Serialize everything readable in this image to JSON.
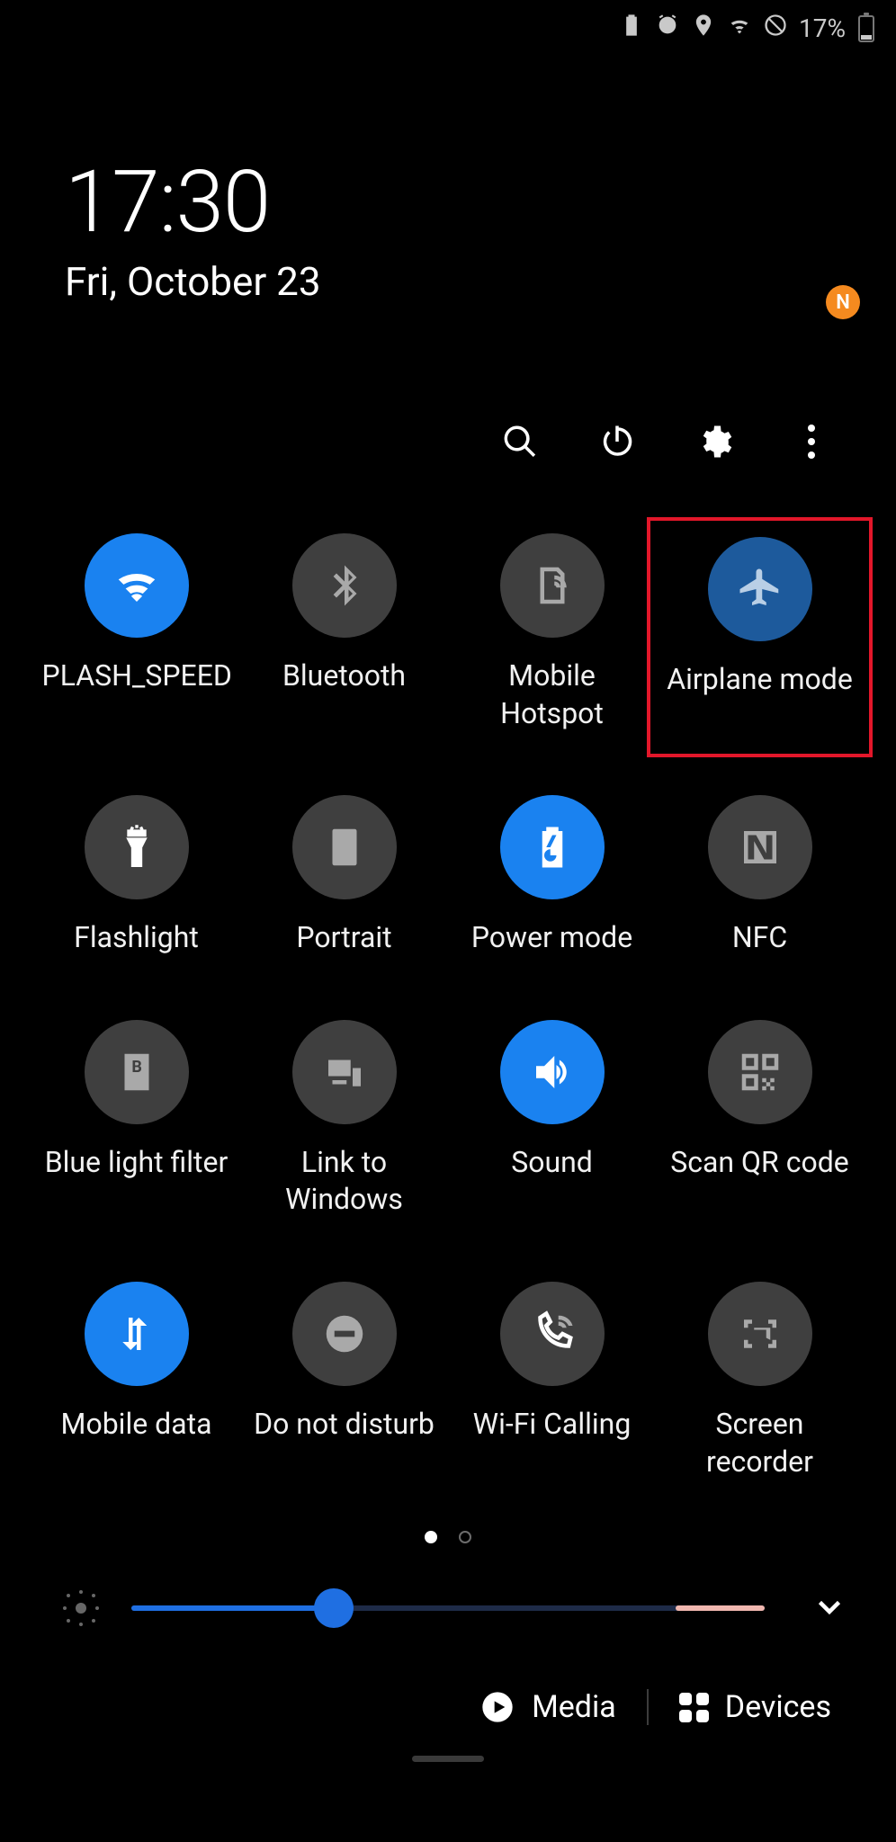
{
  "status_bar": {
    "battery_percent": "17%"
  },
  "clock": {
    "time": "17:30",
    "date": "Fri, October 23"
  },
  "action_row": {
    "badge": "N"
  },
  "tiles": [
    {
      "id": "wifi",
      "label": "PLASH_SPEED",
      "state": "active",
      "icon": "wifi-icon",
      "highlight": false
    },
    {
      "id": "bluetooth",
      "label": "Bluetooth",
      "state": "off",
      "icon": "bluetooth-icon",
      "highlight": false
    },
    {
      "id": "hotspot",
      "label": "Mobile Hotspot",
      "state": "off",
      "icon": "hotspot-icon",
      "highlight": false
    },
    {
      "id": "airplane",
      "label": "Airplane mode",
      "state": "active-dim",
      "icon": "airplane-icon",
      "highlight": true
    },
    {
      "id": "flashlight",
      "label": "Flashlight",
      "state": "off",
      "icon": "flashlight-icon",
      "highlight": false
    },
    {
      "id": "portrait",
      "label": "Portrait",
      "state": "off",
      "icon": "portrait-icon",
      "highlight": false
    },
    {
      "id": "powermode",
      "label": "Power mode",
      "state": "active",
      "icon": "powermode-icon",
      "highlight": false
    },
    {
      "id": "nfc",
      "label": "NFC",
      "state": "off",
      "icon": "nfc-icon",
      "highlight": false
    },
    {
      "id": "bluelight",
      "label": "Blue light filter",
      "state": "off",
      "icon": "bluelight-icon",
      "highlight": false
    },
    {
      "id": "linkwin",
      "label": "Link to Windows",
      "state": "off",
      "icon": "linkwin-icon",
      "highlight": false
    },
    {
      "id": "sound",
      "label": "Sound",
      "state": "active",
      "icon": "sound-icon",
      "highlight": false
    },
    {
      "id": "qr",
      "label": "Scan QR code",
      "state": "off",
      "icon": "qr-icon",
      "highlight": false
    },
    {
      "id": "mobiledata",
      "label": "Mobile data",
      "state": "active",
      "icon": "mobiledata-icon",
      "highlight": false
    },
    {
      "id": "dnd",
      "label": "Do not disturb",
      "state": "off",
      "icon": "dnd-icon",
      "highlight": false
    },
    {
      "id": "wificall",
      "label": "Wi-Fi Calling",
      "state": "off",
      "icon": "wificall-icon",
      "highlight": false
    },
    {
      "id": "screenrec",
      "label": "Screen recorder",
      "state": "off",
      "icon": "screenrec-icon",
      "highlight": false
    }
  ],
  "pagination": {
    "current": 1,
    "total": 2
  },
  "brightness": {
    "percent": 32,
    "warn_zone_percent": 14
  },
  "bottom": {
    "media_label": "Media",
    "devices_label": "Devices"
  }
}
